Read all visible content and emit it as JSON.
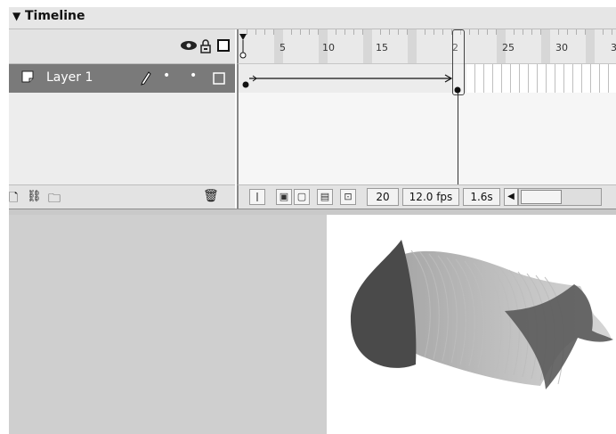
{
  "panel": {
    "title": "Timeline",
    "collapse_glyph": "▼"
  },
  "header_icons": [
    "eye-icon",
    "lock-icon",
    "outline-square-icon"
  ],
  "layer": {
    "name": "Layer 1",
    "icon": "layer-page-icon",
    "pencil_icon": "pencil-icon",
    "dot_glyph": "•",
    "outline_glyph": "☐"
  },
  "ruler": {
    "ticks": [
      "5",
      "10",
      "15",
      "2",
      "25",
      "30",
      "3"
    ],
    "current_frame_marker": "20"
  },
  "status": {
    "current_frame": "20",
    "frame_rate": "12.0 fps",
    "elapsed_time": "1.6s"
  },
  "left_bottom": {
    "add_layer_glyph": "🗋",
    "motion_guide_glyph": "⛓",
    "folder_glyph": "🗀",
    "trash_glyph": "🗑"
  },
  "icons": {
    "center_frame": "ǀ",
    "onion_skin": "▣",
    "onion_skin_outlines": "▢",
    "edit_multiple": "▤",
    "modify_markers": "⊡",
    "scroll_left": "◀"
  },
  "colors": {
    "layer_selected": "#7a7a7a",
    "shape_dark": "#4a4a4a",
    "stage_bg": "#ffffff",
    "workarea_bg": "#cfcfcf"
  }
}
